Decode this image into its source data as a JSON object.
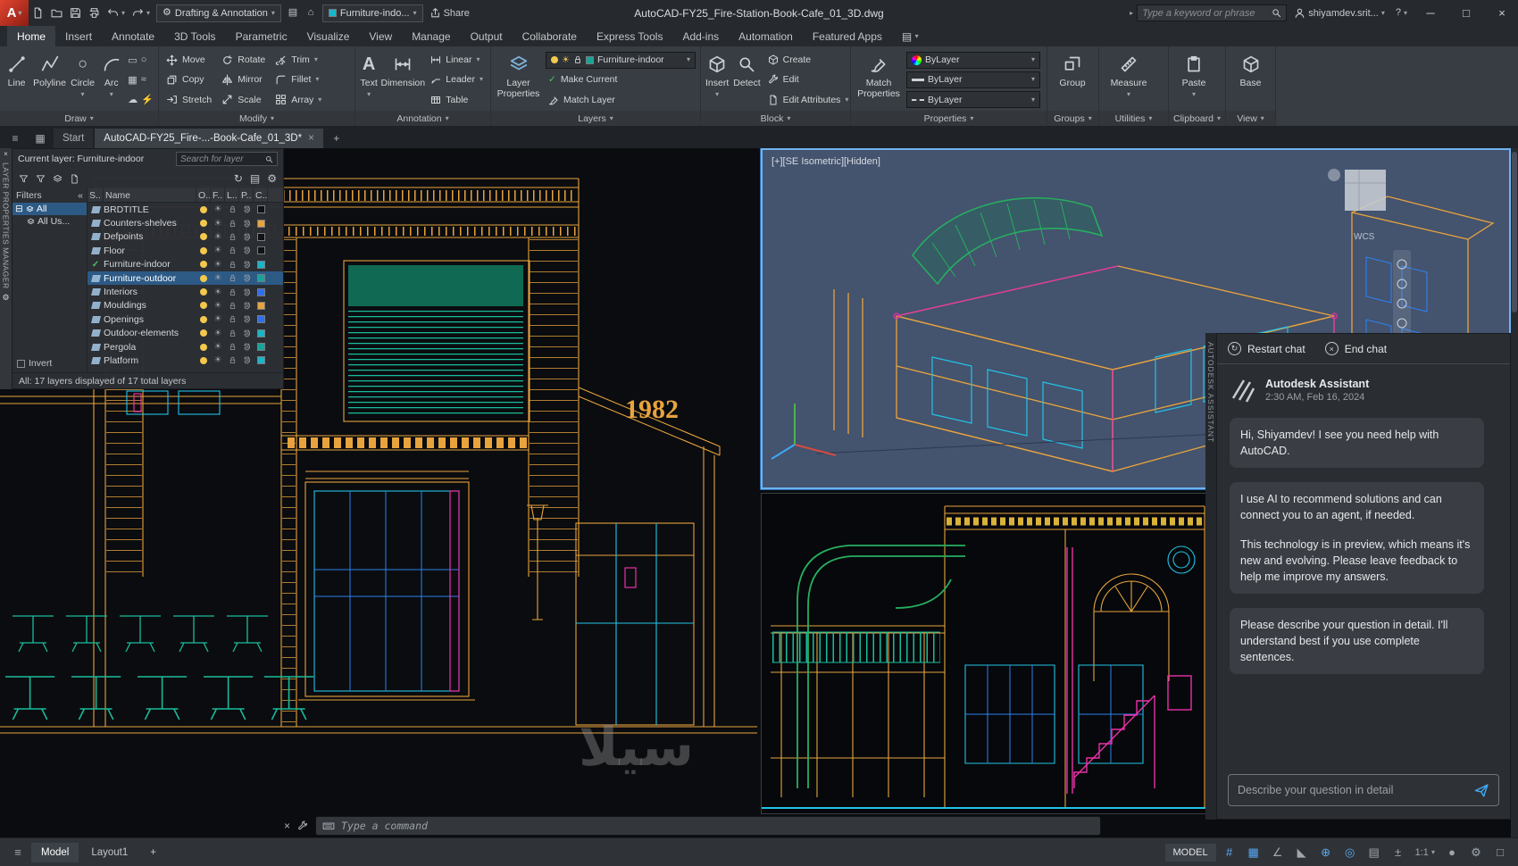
{
  "colors": {
    "accent_blue": "#5AA7F0",
    "autocad_red": "#E0452F",
    "cad_orange": "#E8A33D",
    "cad_cyan": "#22C3E6",
    "cad_blue": "#2F80ED",
    "cad_magenta": "#E832A8",
    "cad_teal": "#1ABC9C",
    "cad_green": "#27AE60"
  },
  "titlebar": {
    "workspace": "Drafting & Annotation",
    "quick_layer": "Furniture-indo...",
    "share": "Share",
    "title": "AutoCAD-FY25_Fire-Station-Book-Cafe_01_3D.dwg",
    "search_placeholder": "Type a keyword or phrase",
    "user": "shiyamdev.srit..."
  },
  "ribbon_tabs": [
    "Home",
    "Insert",
    "Annotate",
    "3D Tools",
    "Parametric",
    "Visualize",
    "View",
    "Manage",
    "Output",
    "Collaborate",
    "Express Tools",
    "Add-ins",
    "Automation",
    "Featured Apps"
  ],
  "panels": {
    "draw": {
      "label": "Draw",
      "line": "Line",
      "polyline": "Polyline",
      "circle": "Circle",
      "arc": "Arc"
    },
    "modify": {
      "label": "Modify",
      "move": "Move",
      "rotate": "Rotate",
      "trim": "Trim",
      "copy": "Copy",
      "mirror": "Mirror",
      "fillet": "Fillet",
      "stretch": "Stretch",
      "scale": "Scale",
      "array": "Array"
    },
    "annotation": {
      "label": "Annotation",
      "text": "Text",
      "dimension": "Dimension",
      "linear": "Linear",
      "leader": "Leader",
      "table": "Table"
    },
    "layers": {
      "label": "Layers",
      "layer_properties": "Layer Properties",
      "current": "Furniture-indoor",
      "make_current": "Make Current",
      "match_layer": "Match Layer"
    },
    "block": {
      "label": "Block",
      "insert": "Insert",
      "detect": "Detect",
      "create": "Create",
      "edit": "Edit",
      "edit_attributes": "Edit Attributes"
    },
    "properties": {
      "label": "Properties",
      "match_properties": "Match Properties",
      "color": "ByLayer",
      "lineweight": "ByLayer",
      "linetype": "ByLayer"
    },
    "groups": {
      "label": "Groups",
      "group": "Group"
    },
    "utilities": {
      "label": "Utilities",
      "measure": "Measure"
    },
    "clipboard": {
      "label": "Clipboard",
      "paste": "Paste"
    },
    "view": {
      "label": "View",
      "base": "Base"
    }
  },
  "file_tabs": {
    "start": "Start",
    "drawing": "AutoCAD-FY25_Fire-...-Book-Cafe_01_3D*"
  },
  "layer_manager": {
    "vertical_title": "LAYER PROPERTIES MANAGER",
    "current_layer": "Current layer: Furniture-indoor",
    "search_placeholder": "Search for layer",
    "filters": "Filters",
    "tree_all": "All",
    "tree_all_used": "All Us...",
    "columns": {
      "status": "S..",
      "name": "Name",
      "on": "O..",
      "freeze": "F..",
      "lock": "L..",
      "plot": "P..",
      "color": "C.."
    },
    "layers": [
      {
        "name": "BRDTITLE",
        "color": "#101214"
      },
      {
        "name": "Counters-shelves",
        "color": "#E8A33D"
      },
      {
        "name": "Defpoints",
        "color": "#101214"
      },
      {
        "name": "Floor",
        "color": "#101214"
      },
      {
        "name": "Furniture-indoor",
        "color": "#19B5C8"
      },
      {
        "name": "Furniture-outdoor",
        "color": "#16A59B"
      },
      {
        "name": "Interiors",
        "color": "#2F6FED"
      },
      {
        "name": "Mouldings",
        "color": "#E8A33D"
      },
      {
        "name": "Openings",
        "color": "#2F6FED"
      },
      {
        "name": "Outdoor-elements",
        "color": "#19B5C8"
      },
      {
        "name": "Pergola",
        "color": "#16A59B"
      },
      {
        "name": "Platform",
        "color": "#19B5C8"
      }
    ],
    "invert": "Invert",
    "status_text": "All: 17 layers displayed of 17 total layers"
  },
  "viewport_iso": {
    "label": "[+][SE Isometric][Hidden]",
    "wcs": "WCS"
  },
  "drawing_text": {
    "year": "1982"
  },
  "assistant": {
    "vertical_title": "AUTODESK ASSISTANT",
    "restart": "Restart chat",
    "end": "End chat",
    "name": "Autodesk Assistant",
    "timestamp": "2:30 AM, Feb 16, 2024",
    "msg1": "Hi, Shiyamdev! I see you need help with AutoCAD.",
    "msg2a": "I use AI to recommend solutions and can connect you to an agent, if needed.",
    "msg2b": "This technology is in preview, which means it's new and evolving. Please leave feedback to help me improve my answers.",
    "msg3": "Please describe your question in detail. I'll understand best if you use complete sentences.",
    "input_placeholder": "Describe your question in detail"
  },
  "command": {
    "placeholder": "Type a command"
  },
  "status": {
    "model_space": "MODEL",
    "model_tab": "Model",
    "layout1_tab": "Layout1",
    "scale": "1:1"
  },
  "watermark": "سيلا"
}
